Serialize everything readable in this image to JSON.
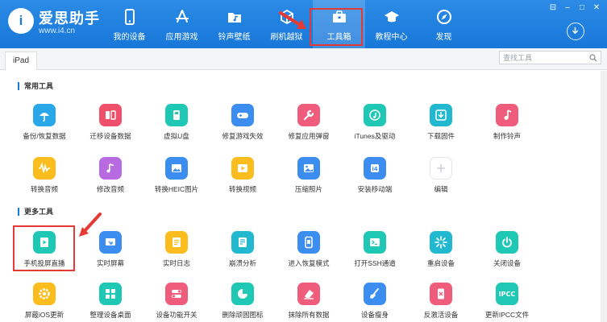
{
  "brand": {
    "name": "爱思助手",
    "url": "www.i4.cn"
  },
  "nav": [
    {
      "label": "我的设备",
      "icon": "phone-icon"
    },
    {
      "label": "应用游戏",
      "icon": "app-store-icon"
    },
    {
      "label": "铃声壁纸",
      "icon": "music-folder-icon"
    },
    {
      "label": "刷机越狱",
      "icon": "box-icon"
    },
    {
      "label": "工具箱",
      "icon": "toolbox-icon",
      "active": true
    },
    {
      "label": "教程中心",
      "icon": "graduation-cap-icon"
    },
    {
      "label": "发现",
      "icon": "compass-icon"
    }
  ],
  "window_controls": [
    "⊟",
    "–",
    "□",
    "✕"
  ],
  "tab": {
    "label": "iPad"
  },
  "search": {
    "placeholder": "查找工具"
  },
  "sections": [
    {
      "title": "常用工具",
      "tools": [
        {
          "label": "备份/恢复数据",
          "icon": "umbrella-icon",
          "color": "#2aa7e8"
        },
        {
          "label": "迁移设备数据",
          "icon": "transfer-icon",
          "color": "#ef4f6b"
        },
        {
          "label": "虚拟U盘",
          "icon": "usb-drive-icon",
          "color": "#1fc7b5"
        },
        {
          "label": "修复游戏失效",
          "icon": "gamepad-icon",
          "color": "#3b8df0"
        },
        {
          "label": "修复应用弹窗",
          "icon": "wrench-icon",
          "color": "#f05c7c"
        },
        {
          "label": "iTunes及驱动",
          "icon": "music-note-icon",
          "color": "#1fc7b5"
        },
        {
          "label": "下载固件",
          "icon": "download-box-icon",
          "color": "#22b8cf"
        },
        {
          "label": "制作铃声",
          "icon": "bell-music-icon",
          "color": "#f05c7c"
        },
        {
          "label": "转换音频",
          "icon": "waveform-icon",
          "color": "#fbbd1d"
        },
        {
          "label": "修改音频",
          "icon": "music-edit-icon",
          "color": "#b86be0"
        },
        {
          "label": "转换HEIC图片",
          "icon": "image-convert-icon",
          "color": "#3b8df0"
        },
        {
          "label": "转换视频",
          "icon": "video-icon",
          "color": "#fbbd1d"
        },
        {
          "label": "压缩照片",
          "icon": "photo-icon",
          "color": "#3b8df0"
        },
        {
          "label": "安装移动端",
          "icon": "i4-app-icon",
          "color": "#3b8df0"
        },
        {
          "label": "编辑",
          "icon": "plus-icon",
          "color": "#ffffff"
        }
      ]
    },
    {
      "title": "更多工具",
      "tools": [
        {
          "label": "手机投屏直播",
          "icon": "screen-cast-icon",
          "color": "#1fc7b5"
        },
        {
          "label": "实时屏幕",
          "icon": "realtime-screen-icon",
          "color": "#3b8df0"
        },
        {
          "label": "实时日志",
          "icon": "log-icon",
          "color": "#fbbd1d"
        },
        {
          "label": "崩溃分析",
          "icon": "crash-report-icon",
          "color": "#22b8cf"
        },
        {
          "label": "进入恢复模式",
          "icon": "recovery-mode-icon",
          "color": "#3b8df0"
        },
        {
          "label": "打开SSH通道",
          "icon": "terminal-icon",
          "color": "#1fc7b5"
        },
        {
          "label": "重启设备",
          "icon": "sparkle-icon",
          "color": "#22b8cf"
        },
        {
          "label": "关闭设备",
          "icon": "power-icon",
          "color": "#1fc7b5"
        },
        {
          "label": "屏蔽iOS更新",
          "icon": "gear-shield-icon",
          "color": "#fbbd1d"
        },
        {
          "label": "整理设备桌面",
          "icon": "grid-icon",
          "color": "#1fc7b5"
        },
        {
          "label": "设备功能开关",
          "icon": "toggle-icon",
          "color": "#f05c7c"
        },
        {
          "label": "删除顽固图标",
          "icon": "pie-icon",
          "color": "#1fc7b5"
        },
        {
          "label": "抹除所有数据",
          "icon": "eraser-icon",
          "color": "#f05c7c"
        },
        {
          "label": "设备瘦身",
          "icon": "broom-icon",
          "color": "#3b8df0"
        },
        {
          "label": "反激活设备",
          "icon": "phone-x-icon",
          "color": "#f05c7c"
        },
        {
          "label": "更新IPCC文件",
          "icon": "ipcc-icon",
          "color": "#1fc7b5",
          "badge": "IPCC"
        }
      ]
    }
  ]
}
